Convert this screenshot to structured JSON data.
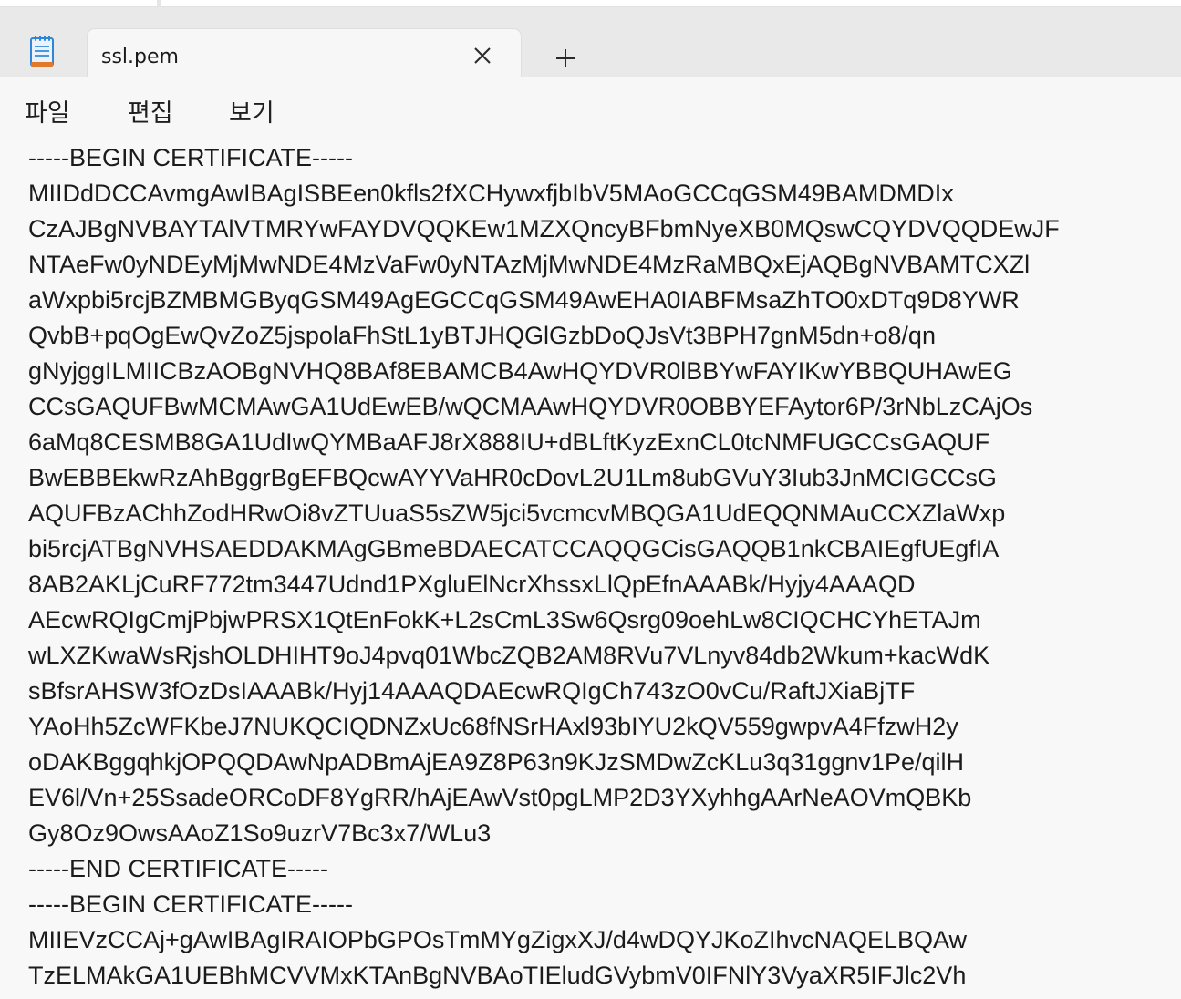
{
  "tab": {
    "title": "ssl.pem"
  },
  "menu": {
    "items": [
      "파일",
      "편집",
      "보기"
    ]
  },
  "editor": {
    "lines": [
      "-----BEGIN CERTIFICATE-----",
      "MIIDdDCCAvmgAwIBAgISBEen0kfls2fXCHywxfjbIbV5MAoGCCqGSM49BAMDMDIx",
      "CzAJBgNVBAYTAlVTMRYwFAYDVQQKEw1MZXQncyBFbmNyeXB0MQswCQYDVQQDEwJF",
      "NTAeFw0yNDEyMjMwNDE4MzVaFw0yNTAzMjMwNDE4MzRaMBQxEjAQBgNVBAMTCXZl",
      "aWxpbi5rcjBZMBMGByqGSM49AgEGCCqGSM49AwEHA0IABFMsaZhTO0xDTq9D8YWR",
      "QvbB+pqOgEwQvZoZ5jspolaFhStL1yBTJHQGlGzbDoQJsVt3BPH7gnM5dn+o8/qn",
      "gNyjggILMIICBzAOBgNVHQ8BAf8EBAMCB4AwHQYDVR0lBBYwFAYIKwYBBQUHAwEG",
      "CCsGAQUFBwMCMAwGA1UdEwEB/wQCMAAwHQYDVR0OBBYEFAytor6P/3rNbLzCAjOs",
      "6aMq8CESMB8GA1UdIwQYMBaAFJ8rX888IU+dBLftKyzExnCL0tcNMFUGCCsGAQUF",
      "BwEBBEkwRzAhBggrBgEFBQcwAYYVaHR0cDovL2U1Lm8ubGVuY3Iub3JnMCIGCCsG",
      "AQUFBzAChhZodHRwOi8vZTUuaS5sZW5jci5vcmcvMBQGA1UdEQQNMAuCCXZlaWxp",
      "bi5rcjATBgNVHSAEDDAKMAgGBmeBDAECATCCAQQGCisGAQQB1nkCBAIEgfUEgfIA",
      "8AB2AKLjCuRF772tm3447Udnd1PXgluElNcrXhssxLlQpEfnAAABk/Hyjy4AAAQD",
      "AEcwRQIgCmjPbjwPRSX1QtEnFokK+L2sCmL3Sw6Qsrg09oehLw8CIQCHCYhETAJm",
      "wLXZKwaWsRjshOLDHIHT9oJ4pvq01WbcZQB2AM8RVu7VLnyv84db2Wkum+kacWdK",
      "sBfsrAHSW3fOzDsIAAABk/Hyj14AAAQDAEcwRQIgCh743zO0vCu/RaftJXiaBjTF",
      "YAoHh5ZcWFKbeJ7NUKQCIQDNZxUc68fNSrHAxl93bIYU2kQV559gwpvA4FfzwH2y",
      "oDAKBggqhkjOPQQDAwNpADBmAjEA9Z8P63n9KJzSMDwZcKLu3q31ggnv1Pe/qilH",
      "EV6l/Vn+25SsadeORCoDF8YgRR/hAjEAwVst0pgLMP2D3YXyhhgAArNeAOVmQBKb",
      "Gy8Oz9OwsAAoZ1So9uzrV7Bc3x7/WLu3",
      "-----END CERTIFICATE-----",
      "-----BEGIN CERTIFICATE-----",
      "MIIEVzCCAj+gAwIBAgIRAIOPbGPOsTmMYgZigxXJ/d4wDQYJKoZIhvcNAQELBQAw",
      "TzELMAkGA1UEBhMCVVMxKTAnBgNVBAoTIEludGVybmV0IFNlY3VyaXR5IFJlc2Vh"
    ]
  },
  "colors": {
    "titlebar": "#e9e9e9",
    "tab_active": "#f7f7f7",
    "editor_bg": "#f8f8f8",
    "text": "#1b1b1b",
    "icon_blue": "#2f86d6",
    "icon_orange": "#e07a2a"
  },
  "icons": {
    "app": "notepad-icon",
    "close": "close-icon",
    "new_tab": "plus-icon"
  }
}
